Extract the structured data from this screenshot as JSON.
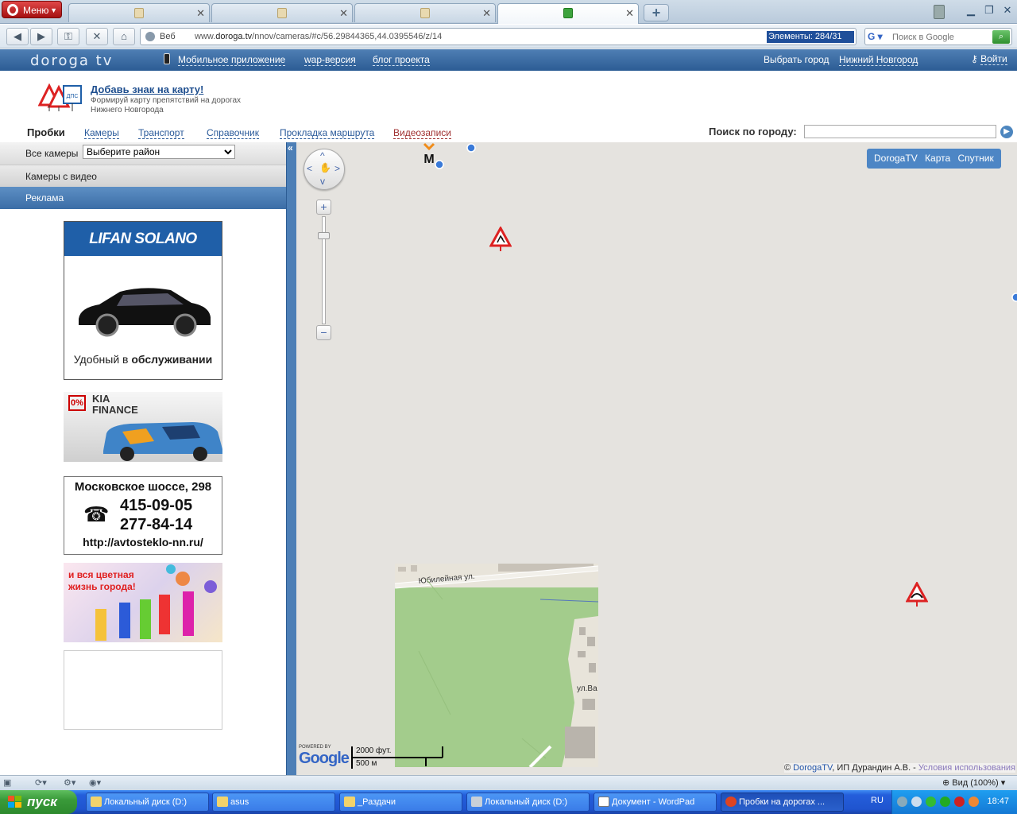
{
  "browser": {
    "menu_label": "Меню",
    "tabs": [
      {
        "label": ""
      },
      {
        "label": ""
      },
      {
        "label": ""
      },
      {
        "label": ""
      }
    ],
    "address": {
      "web_label": "Веб",
      "url_host": "www.dorogа.tv",
      "url_prefix": "www.",
      "url_domain": "doroga.tv",
      "url_path": "/nnov/cameras/#c/56.29844365,44.0395546/z/14",
      "elements_counter": "Элементы:  284/31"
    },
    "search": {
      "engine": "Google",
      "placeholder": "Поиск в Google"
    },
    "zoom_label": "Вид (100%)"
  },
  "site": {
    "logo": "doroga tv",
    "top_links": [
      "Мобильное приложение",
      "wap-версия",
      "блог проекта"
    ],
    "choose_city_label": "Выбрать город",
    "current_city": "Нижний Новгород",
    "login": "Войти",
    "promo": {
      "title": "Добавь знак на карту!",
      "subtitle": "Формируй карту препятствий на дорогах Нижнего Новгорода",
      "sign_label": "ДПС"
    },
    "nav": [
      "Пробки",
      "Камеры",
      "Транспорт",
      "Справочник",
      "Прокладка маршрута",
      "Видеозаписи"
    ],
    "city_search_label": "Поиск по городу:"
  },
  "sidebar": {
    "all_cameras_label": "Все камеры",
    "district_select": "Выберите район",
    "cameras_with_video": "Камеры с видео",
    "ads_header": "Реклама",
    "ads": {
      "lifan_brand": "LIFAN SOLANO",
      "lifan_slogan_pre": "Удобный в ",
      "lifan_slogan_bold": "обслуживании",
      "kia_percent": "0%",
      "kia_title_1": "KIA",
      "kia_title_2": "FINANCE",
      "glass_address": "Московское шоссе, 298",
      "glass_phone_icon": "☎",
      "glass_phone_1": "415-09-05",
      "glass_phone_2": "277-84-14",
      "glass_url": "http://avtosteklo-nn.ru/",
      "colorful_text": "и вся цветная жизнь города!"
    }
  },
  "map": {
    "collapse_glyph": "«",
    "types": [
      "DorogaTV",
      "Карта",
      "Спутник"
    ],
    "street_labels": [
      "Юбилейная ул.",
      "ул.Ва"
    ],
    "metro_letter": "М",
    "scale_ft": "2000 фут.",
    "scale_m": "500 м",
    "powered_by": "POWERED BY",
    "google_logo": "Google",
    "copyright_prefix": "© ",
    "copyright_link": "DorogaTV",
    "copyright_mid": ", ИП Дурандин А.В. - ",
    "terms": "Условия использования"
  },
  "taskbar": {
    "start_label": "пуск",
    "tasks": [
      "Локальный диск (D:)",
      "asus",
      "_Раздачи",
      "Локальный диск (D:)",
      "Документ - WordPad",
      "Пробки на дорогах ..."
    ],
    "lang": "RU",
    "clock": "18:47"
  },
  "colors": {
    "site_blue": "#2c5c94",
    "map_bg": "#e5e3df",
    "park_green": "#a3cc8c",
    "taskbar_blue": "#245edb"
  }
}
